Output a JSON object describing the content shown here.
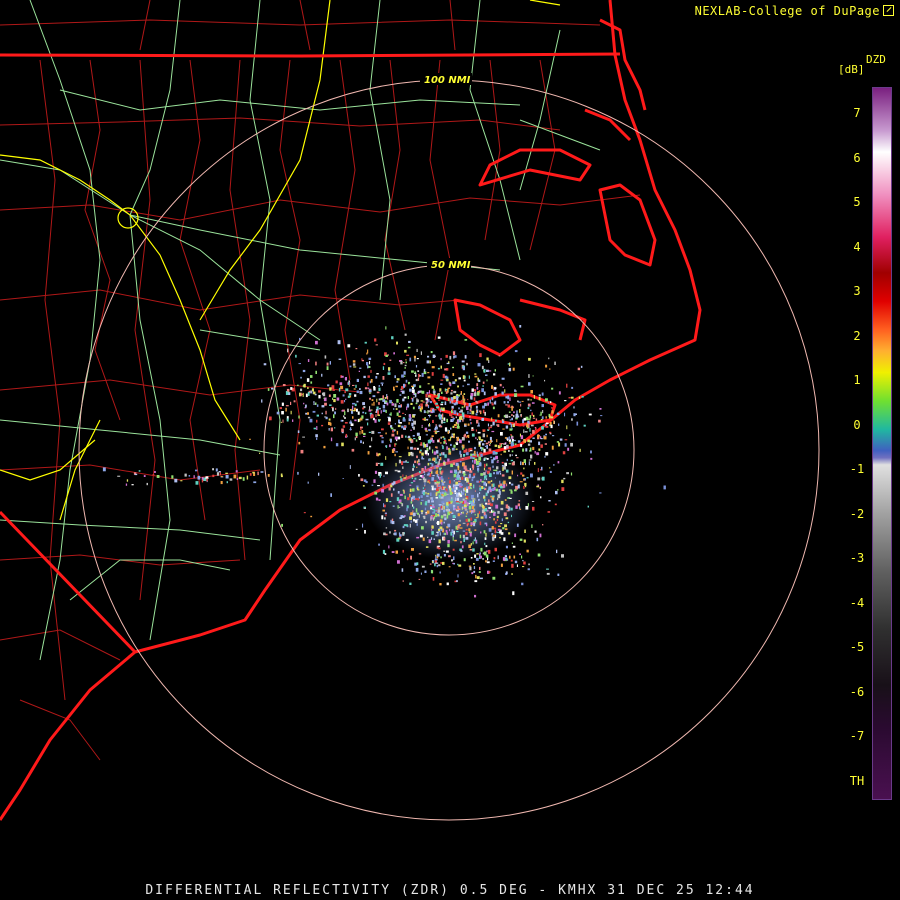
{
  "credit": "NEXLAB-College of DuPage",
  "credit_icon": "external-link-icon",
  "footer": "DIFFERENTIAL REFLECTIVITY (ZDR) 0.5 DEG - KMHX 31 DEC 25 12:44",
  "rings": [
    {
      "label": "50 NMI"
    },
    {
      "label": "100 NMI"
    }
  ],
  "legend": {
    "product": "DZD",
    "unit": "[dB]",
    "ticks": [
      "7",
      "6",
      "5",
      "4",
      "3",
      "2",
      "1",
      "0",
      "-1",
      "-2",
      "-3",
      "-4",
      "-5",
      "-6",
      "-7",
      "TH"
    ]
  },
  "colors": {
    "background": "#000000",
    "state_border": "#ff1a1a",
    "county_line": "#b01818",
    "highway_major": "#ffff00",
    "highway_minor": "#9be39b",
    "range_ring": "#f0b8b0",
    "text": "#ffff33"
  }
}
